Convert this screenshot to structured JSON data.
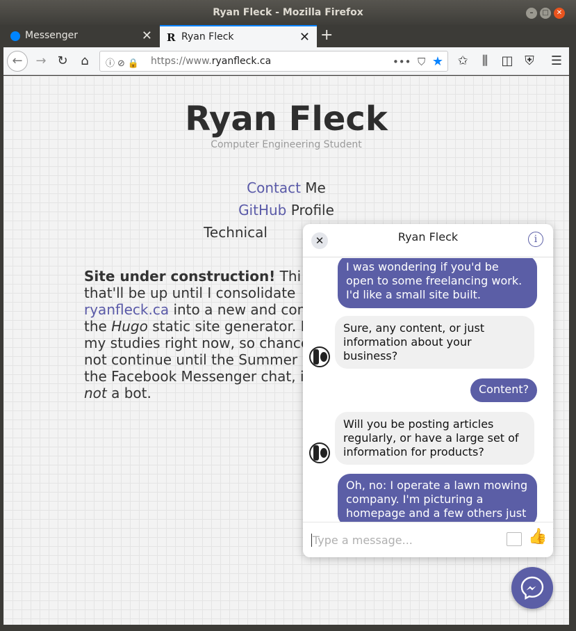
{
  "window": {
    "title": "Ryan Fleck - Mozilla Firefox"
  },
  "tabs": [
    {
      "label": "Messenger",
      "active": false
    },
    {
      "label": "Ryan Fleck",
      "active": true
    }
  ],
  "urlbar": {
    "url_prefix": "https://www.",
    "url_domain": "ryanfleck.ca"
  },
  "page": {
    "title": "Ryan Fleck",
    "subtitle": "Computer Engineering Student",
    "links": [
      {
        "link": "Contact",
        "rest": " Me"
      },
      {
        "link": "GitHub",
        "rest": " Profile"
      },
      {
        "link": "",
        "rest": "Technical"
      }
    ],
    "paragraph": {
      "bold": "Site under construction!",
      "lines": [
        "Thi",
        "that'll be up until I consolidate",
        "into a new and con",
        "static site generator. I",
        "my studies right now, so chance",
        "not continue until the Summer",
        "the Facebook Messenger chat, i",
        "a bot."
      ],
      "link": "ryanfleck.ca",
      "the": "the ",
      "hugo": "Hugo",
      "not": "not"
    }
  },
  "chat": {
    "name": "Ryan Fleck",
    "messages": [
      {
        "from": "me",
        "text": "I was wondering if you'd be open to some freelancing work. I'd like a small site built."
      },
      {
        "from": "them",
        "text": "Sure, any content, or just information about your business?"
      },
      {
        "from": "me",
        "text": "Content?"
      },
      {
        "from": "them",
        "text": "Will you be posting articles regularly, or have a large set of information for products?"
      },
      {
        "from": "me",
        "text": "Oh, no: I operate a lawn mowing company. I'm picturing a homepage and a few others just"
      }
    ],
    "input_placeholder": "Type a message..."
  },
  "colors": {
    "accent": "#5b5ea6",
    "link": "#5a5aa8",
    "firefox_blue": "#0a84ff"
  },
  "icons": {
    "close": "✕",
    "min": "–",
    "max": "□",
    "new_tab": "+",
    "tab_close": "✕",
    "back": "←",
    "forward": "→",
    "reload": "↻",
    "home": "⌂",
    "more": "•••",
    "star": "★",
    "menu": "☰",
    "info": "i",
    "like": "👍"
  }
}
